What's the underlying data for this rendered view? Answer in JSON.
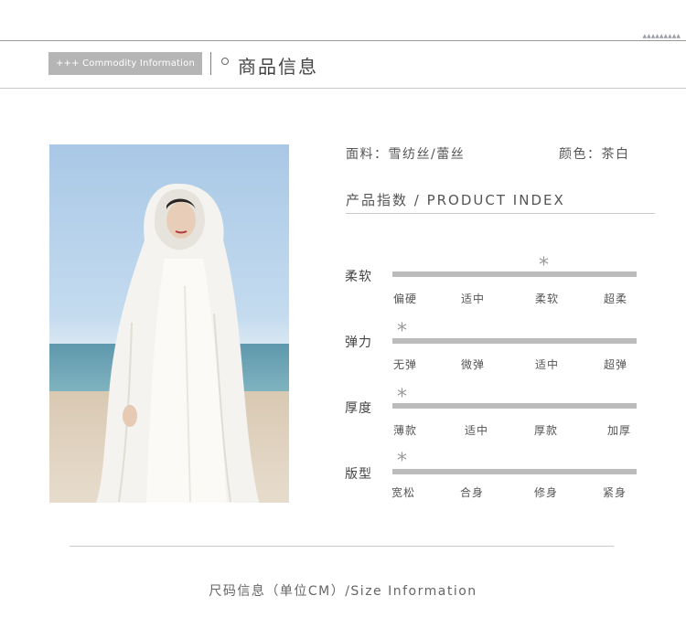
{
  "header": {
    "tag": "+++ Commodity Information",
    "title": "商品信息",
    "deco": "▲▲▲▲▲▲▲▲▲"
  },
  "product": {
    "fabric": "面料：雪纺丝/蕾丝",
    "color": "颜色：茶白",
    "photo_alt": "white hooded chiffon cape on beach"
  },
  "index": {
    "title": "产品指数 / PRODUCT INDEX",
    "attributes": [
      {
        "label": "柔软",
        "options": [
          "偏硬",
          "适中",
          "柔软",
          "超柔"
        ],
        "selected_index": 2
      },
      {
        "label": "弹力",
        "options": [
          "无弹",
          "微弹",
          "适中",
          "超弹"
        ],
        "selected_index": 0
      },
      {
        "label": "厚度",
        "options": [
          "薄款",
          "适中",
          "厚款",
          "加厚"
        ],
        "selected_index": 0
      },
      {
        "label": "版型",
        "options": [
          "宽松",
          "合身",
          "修身",
          "紧身"
        ],
        "selected_index": 0
      }
    ],
    "marker_symbol": "*"
  },
  "footer": {
    "size_info": "尺码信息（单位CM）/Size Information"
  }
}
